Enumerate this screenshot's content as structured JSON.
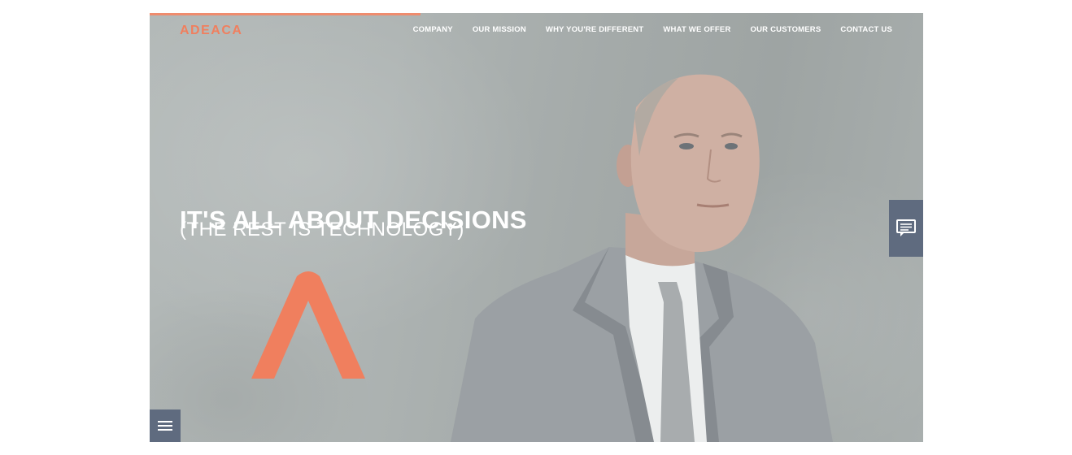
{
  "header": {
    "logo_text": "ADEACA",
    "nav": [
      {
        "label": "COMPANY"
      },
      {
        "label": "OUR MISSION"
      },
      {
        "label": "WHY YOU'RE DIFFERENT"
      },
      {
        "label": "WHAT WE OFFER"
      },
      {
        "label": "OUR CUSTOMERS"
      },
      {
        "label": "CONTACT US"
      }
    ]
  },
  "hero": {
    "headline": "IT'S ALL ABOUT DECISIONS",
    "subheadline": "(THE REST IS TECHNOLOGY)"
  },
  "scroll_progress": 0.35,
  "icons": {
    "logo_mark": "a-chevron-logo-icon",
    "chat": "chat-icon",
    "menu": "hamburger-menu-icon"
  },
  "colors": {
    "brand_accent": "#f07f5e",
    "tab_background": "#5f6b7f",
    "text_light": "#ffffff"
  }
}
